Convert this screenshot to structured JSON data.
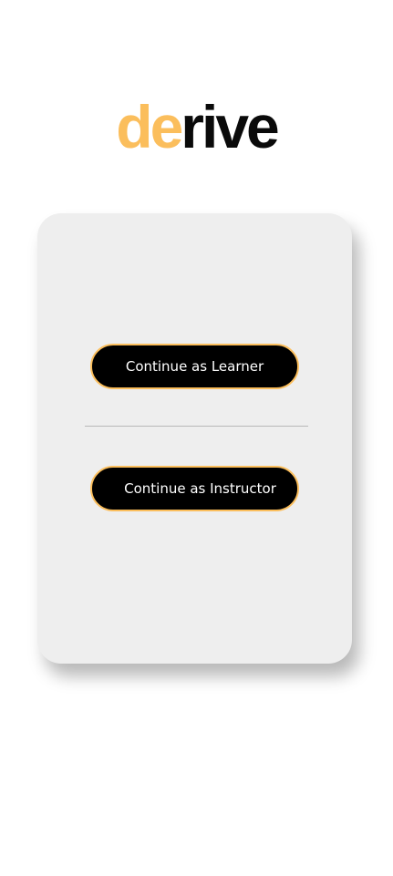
{
  "brand": {
    "logo_accent": "de",
    "logo_rest": "rive",
    "accent_color": "#FBBE5C",
    "dark_color": "#0a0a0a"
  },
  "card": {
    "learner_button_label": "Continue as Learner",
    "instructor_button_label": "Continue as Instructor"
  }
}
